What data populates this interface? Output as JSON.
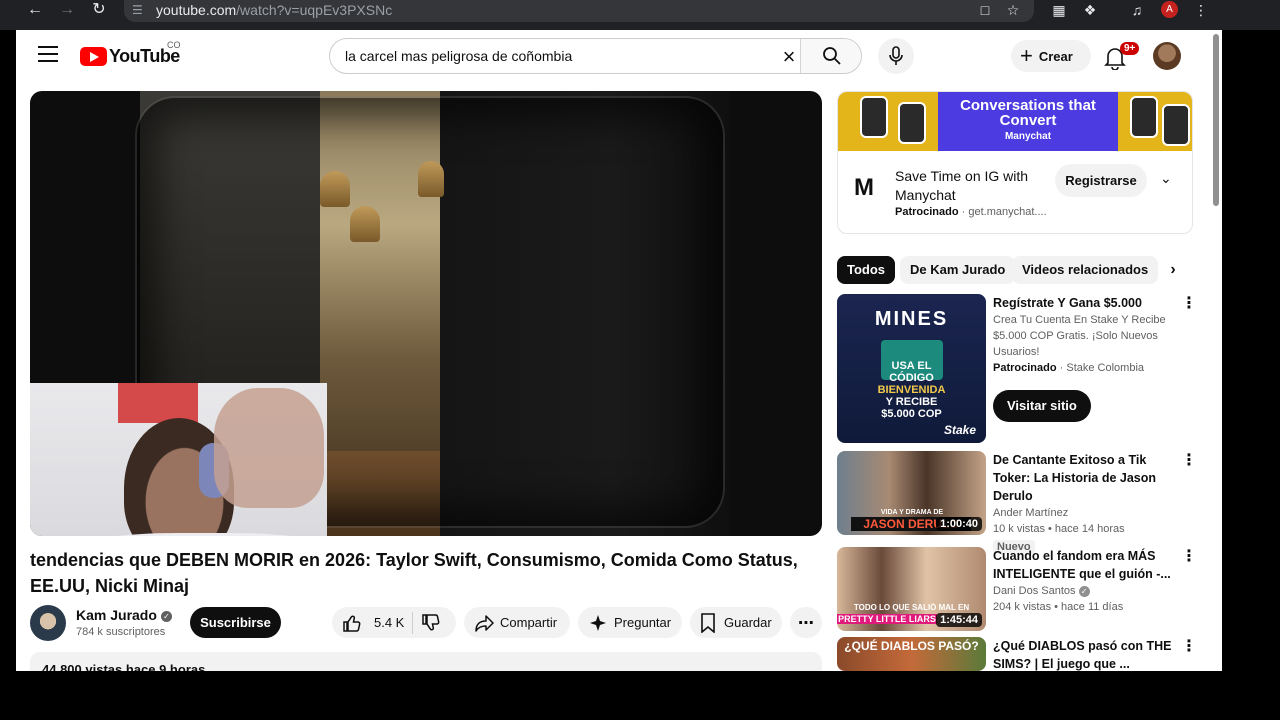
{
  "browser": {
    "url_host": "youtube.com",
    "url_path": "/watch?v=uqpEv3PXSNc",
    "profile_initial": "A"
  },
  "masthead": {
    "logo_text": "YouTube",
    "country_code": "CO",
    "search_value": "la carcel mas peligrosa de coñombia",
    "create_label": "Crear",
    "notif_badge": "9+"
  },
  "video": {
    "title": "tendencias que DEBEN MORIR en 2026: Taylor Swift, Consumismo, Comida Como Status, EE.UU, Nicki Minaj",
    "channel_name": "Kam Jurado",
    "subscribers": "784 k suscriptores",
    "subscribe_label": "Suscribirse",
    "likes": "5.4 K",
    "share_label": "Compartir",
    "ask_label": "Preguntar",
    "save_label": "Guardar",
    "description_meta": "44.800 vistas  hace 9 horas"
  },
  "ad": {
    "banner_title": "Conversations that Convert",
    "banner_brand": "Manychat",
    "logo_text": "M",
    "headline": "Save Time on IG with Manychat",
    "sponsored": "Patrocinado",
    "domain": "get.manychat....",
    "register_label": "Registrarse"
  },
  "chips": [
    "Todos",
    "De Kam Jurado",
    "Videos relacionados"
  ],
  "recommendations": {
    "sponsored_card": {
      "title": "Regístrate Y Gana $5.000",
      "description": "Crea Tu Cuenta En Stake Y Recibe $5.000 COP Gratis. ¡Solo Nuevos Usuarios!",
      "sponsored": "Patrocinado",
      "advertiser": "Stake Colombia",
      "cta": "Visitar sitio",
      "thumb_lines": [
        "MINES",
        "USA EL",
        "CÓDIGO",
        "BIENVENIDA",
        "Y RECIBE",
        "$5.000 COP"
      ],
      "thumb_brand": "Stake"
    },
    "items": [
      {
        "title": "De Cantante Exitoso a Tik Toker: La Historia de Jason Derulo",
        "channel": "Ander Martínez",
        "meta": "10 k vistas • hace 14 horas",
        "badge": "Nuevo",
        "duration": "1:00:40",
        "thumb_text": "VIDA Y DRAMA DE",
        "thumb_text2": "JASON DERULO"
      },
      {
        "title": "Cuando el fandom era MÁS INTELIGENTE que el guión -...",
        "channel": "Dani Dos Santos",
        "meta": "204 k vistas • hace 11 días",
        "duration": "1:45:44",
        "thumb_text": "TODO LO QUE SALIÓ MAL EN",
        "thumb_text2": "PRETTY LITTLE LIARS"
      },
      {
        "title": "¿Qué DIABLOS pasó con THE SIMS? | El juego que ...",
        "thumb_text": "¿QUÉ DIABLOS PASÓ?"
      }
    ]
  }
}
